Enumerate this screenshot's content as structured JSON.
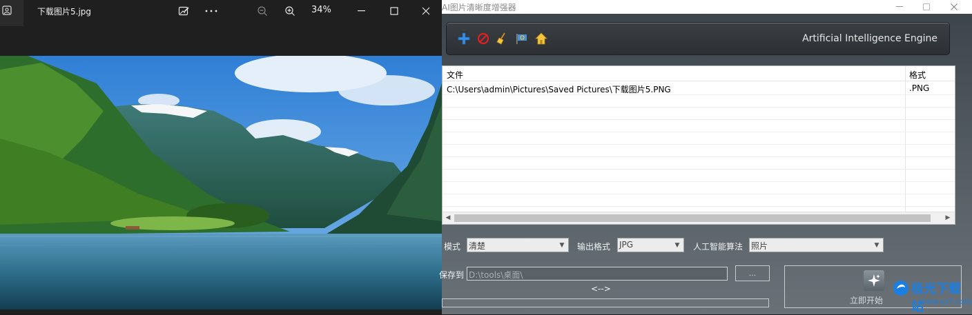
{
  "viewer": {
    "file_name": "下载图片5.jpg",
    "zoom_level": "34%",
    "icons": [
      "photo-app-icon",
      "edit-image-icon",
      "more-icon",
      "zoom-out-icon",
      "zoom-in-icon",
      "minimize-icon",
      "maximize-icon",
      "close-icon"
    ]
  },
  "enhancer": {
    "title": "AI图片清晰度增强器",
    "engine_label": "Artificial Intelligence Engine",
    "toolbar_icons": [
      "add-icon",
      "delete-icon",
      "clear-broom-icon",
      "flag-icon",
      "home-icon"
    ],
    "table": {
      "columns": [
        "文件",
        "格式"
      ],
      "rows": [
        {
          "file": "C:\\Users\\admin\\Pictures\\Saved Pictures\\下载图片5.PNG",
          "format": ".PNG"
        }
      ]
    },
    "options": {
      "mode_label": "模式",
      "mode_value": "清楚",
      "format_label": "输出格式",
      "format_value": "JPG",
      "algo_label": "人工智能算法",
      "algo_value": "照片"
    },
    "save": {
      "label": "保存到",
      "path": "D:\\tools\\桌面\\",
      "browse_label": "...",
      "arrows": "<-->"
    },
    "start_label": "立即开始",
    "watermark": {
      "text": "极光下载站",
      "url": "www.xz7.com"
    }
  }
}
